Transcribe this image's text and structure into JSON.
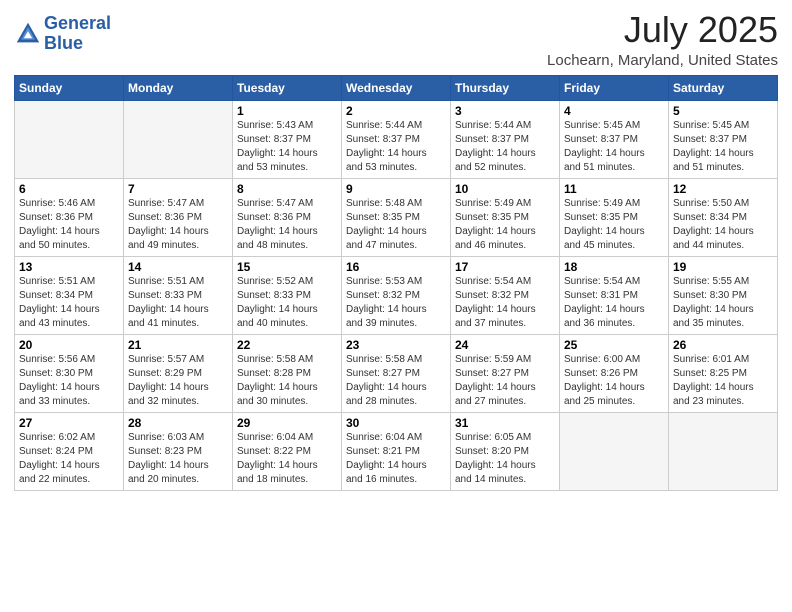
{
  "logo": {
    "line1": "General",
    "line2": "Blue"
  },
  "title": "July 2025",
  "subtitle": "Lochearn, Maryland, United States",
  "weekdays": [
    "Sunday",
    "Monday",
    "Tuesday",
    "Wednesday",
    "Thursday",
    "Friday",
    "Saturday"
  ],
  "weeks": [
    [
      {
        "day": "",
        "sunrise": "",
        "sunset": "",
        "daylight": ""
      },
      {
        "day": "",
        "sunrise": "",
        "sunset": "",
        "daylight": ""
      },
      {
        "day": "1",
        "sunrise": "Sunrise: 5:43 AM",
        "sunset": "Sunset: 8:37 PM",
        "daylight": "Daylight: 14 hours and 53 minutes."
      },
      {
        "day": "2",
        "sunrise": "Sunrise: 5:44 AM",
        "sunset": "Sunset: 8:37 PM",
        "daylight": "Daylight: 14 hours and 53 minutes."
      },
      {
        "day": "3",
        "sunrise": "Sunrise: 5:44 AM",
        "sunset": "Sunset: 8:37 PM",
        "daylight": "Daylight: 14 hours and 52 minutes."
      },
      {
        "day": "4",
        "sunrise": "Sunrise: 5:45 AM",
        "sunset": "Sunset: 8:37 PM",
        "daylight": "Daylight: 14 hours and 51 minutes."
      },
      {
        "day": "5",
        "sunrise": "Sunrise: 5:45 AM",
        "sunset": "Sunset: 8:37 PM",
        "daylight": "Daylight: 14 hours and 51 minutes."
      }
    ],
    [
      {
        "day": "6",
        "sunrise": "Sunrise: 5:46 AM",
        "sunset": "Sunset: 8:36 PM",
        "daylight": "Daylight: 14 hours and 50 minutes."
      },
      {
        "day": "7",
        "sunrise": "Sunrise: 5:47 AM",
        "sunset": "Sunset: 8:36 PM",
        "daylight": "Daylight: 14 hours and 49 minutes."
      },
      {
        "day": "8",
        "sunrise": "Sunrise: 5:47 AM",
        "sunset": "Sunset: 8:36 PM",
        "daylight": "Daylight: 14 hours and 48 minutes."
      },
      {
        "day": "9",
        "sunrise": "Sunrise: 5:48 AM",
        "sunset": "Sunset: 8:35 PM",
        "daylight": "Daylight: 14 hours and 47 minutes."
      },
      {
        "day": "10",
        "sunrise": "Sunrise: 5:49 AM",
        "sunset": "Sunset: 8:35 PM",
        "daylight": "Daylight: 14 hours and 46 minutes."
      },
      {
        "day": "11",
        "sunrise": "Sunrise: 5:49 AM",
        "sunset": "Sunset: 8:35 PM",
        "daylight": "Daylight: 14 hours and 45 minutes."
      },
      {
        "day": "12",
        "sunrise": "Sunrise: 5:50 AM",
        "sunset": "Sunset: 8:34 PM",
        "daylight": "Daylight: 14 hours and 44 minutes."
      }
    ],
    [
      {
        "day": "13",
        "sunrise": "Sunrise: 5:51 AM",
        "sunset": "Sunset: 8:34 PM",
        "daylight": "Daylight: 14 hours and 43 minutes."
      },
      {
        "day": "14",
        "sunrise": "Sunrise: 5:51 AM",
        "sunset": "Sunset: 8:33 PM",
        "daylight": "Daylight: 14 hours and 41 minutes."
      },
      {
        "day": "15",
        "sunrise": "Sunrise: 5:52 AM",
        "sunset": "Sunset: 8:33 PM",
        "daylight": "Daylight: 14 hours and 40 minutes."
      },
      {
        "day": "16",
        "sunrise": "Sunrise: 5:53 AM",
        "sunset": "Sunset: 8:32 PM",
        "daylight": "Daylight: 14 hours and 39 minutes."
      },
      {
        "day": "17",
        "sunrise": "Sunrise: 5:54 AM",
        "sunset": "Sunset: 8:32 PM",
        "daylight": "Daylight: 14 hours and 37 minutes."
      },
      {
        "day": "18",
        "sunrise": "Sunrise: 5:54 AM",
        "sunset": "Sunset: 8:31 PM",
        "daylight": "Daylight: 14 hours and 36 minutes."
      },
      {
        "day": "19",
        "sunrise": "Sunrise: 5:55 AM",
        "sunset": "Sunset: 8:30 PM",
        "daylight": "Daylight: 14 hours and 35 minutes."
      }
    ],
    [
      {
        "day": "20",
        "sunrise": "Sunrise: 5:56 AM",
        "sunset": "Sunset: 8:30 PM",
        "daylight": "Daylight: 14 hours and 33 minutes."
      },
      {
        "day": "21",
        "sunrise": "Sunrise: 5:57 AM",
        "sunset": "Sunset: 8:29 PM",
        "daylight": "Daylight: 14 hours and 32 minutes."
      },
      {
        "day": "22",
        "sunrise": "Sunrise: 5:58 AM",
        "sunset": "Sunset: 8:28 PM",
        "daylight": "Daylight: 14 hours and 30 minutes."
      },
      {
        "day": "23",
        "sunrise": "Sunrise: 5:58 AM",
        "sunset": "Sunset: 8:27 PM",
        "daylight": "Daylight: 14 hours and 28 minutes."
      },
      {
        "day": "24",
        "sunrise": "Sunrise: 5:59 AM",
        "sunset": "Sunset: 8:27 PM",
        "daylight": "Daylight: 14 hours and 27 minutes."
      },
      {
        "day": "25",
        "sunrise": "Sunrise: 6:00 AM",
        "sunset": "Sunset: 8:26 PM",
        "daylight": "Daylight: 14 hours and 25 minutes."
      },
      {
        "day": "26",
        "sunrise": "Sunrise: 6:01 AM",
        "sunset": "Sunset: 8:25 PM",
        "daylight": "Daylight: 14 hours and 23 minutes."
      }
    ],
    [
      {
        "day": "27",
        "sunrise": "Sunrise: 6:02 AM",
        "sunset": "Sunset: 8:24 PM",
        "daylight": "Daylight: 14 hours and 22 minutes."
      },
      {
        "day": "28",
        "sunrise": "Sunrise: 6:03 AM",
        "sunset": "Sunset: 8:23 PM",
        "daylight": "Daylight: 14 hours and 20 minutes."
      },
      {
        "day": "29",
        "sunrise": "Sunrise: 6:04 AM",
        "sunset": "Sunset: 8:22 PM",
        "daylight": "Daylight: 14 hours and 18 minutes."
      },
      {
        "day": "30",
        "sunrise": "Sunrise: 6:04 AM",
        "sunset": "Sunset: 8:21 PM",
        "daylight": "Daylight: 14 hours and 16 minutes."
      },
      {
        "day": "31",
        "sunrise": "Sunrise: 6:05 AM",
        "sunset": "Sunset: 8:20 PM",
        "daylight": "Daylight: 14 hours and 14 minutes."
      },
      {
        "day": "",
        "sunrise": "",
        "sunset": "",
        "daylight": ""
      },
      {
        "day": "",
        "sunrise": "",
        "sunset": "",
        "daylight": ""
      }
    ]
  ]
}
